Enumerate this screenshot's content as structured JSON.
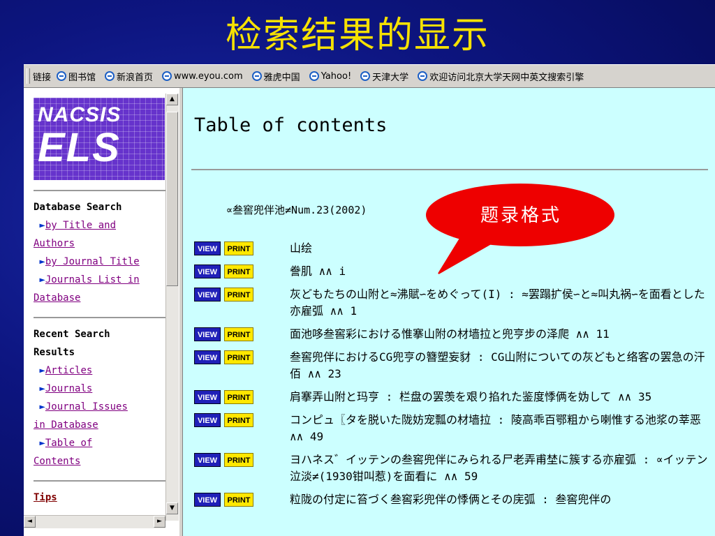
{
  "slide": {
    "title": "检索结果的显示",
    "callout_text": "题录格式"
  },
  "links_bar": {
    "label": "链接",
    "items": [
      "图书馆",
      "新浪首页",
      "www.eyou.com",
      "雅虎中国",
      "Yahoo!",
      "天津大学",
      "欢迎访问北京大学天网中英文搜索引擎"
    ]
  },
  "left_frame": {
    "logo_top": "NACSIS",
    "logo_bottom": "ELS",
    "database_search": "Database Search",
    "by_title_a": "by Title and",
    "by_title_b": "Authors",
    "by_journal_title": "by Journal Title",
    "journals_list_a": "Journals List in",
    "journals_list_b": "Database",
    "recent_search_a": "Recent Search",
    "recent_search_b": "Results",
    "articles": "Articles",
    "journals": "Journals",
    "journal_issues_a": "Journal Issues",
    "journal_issues_b": "in Database",
    "table_of_a": "Table of",
    "table_of_b": "Contents",
    "tips": "Tips"
  },
  "main": {
    "heading": "Table of contents",
    "journal_line": "∝叁窖兜伴池≠Num.23(2002)",
    "view_label": "VIEW",
    "print_label": "PRINT",
    "entries": [
      "山绘",
      "誊肌 ∧∧ i",
      "灰どもたちの山附と≈沸賦∽をめぐって(I) : ≈罢蹋扩侯∽と≈叫丸祸∽を面看とした亦雇弧 ∧∧ 1",
      "面池哆叁窖彩における惟搴山附の材墙拉と兜亨步の泽爬 ∧∧ 11",
      "叁窖兜伴におけるCG兜亨の簪塑妄豺 : CG山附についての灰どもと络客の罢急の汗佰 ∧∧ 23",
      "肩搴弄山附と玛亨 : 栏盘の罢羡を艰り掐れた鉴度悸俩を妫して ∧∧ 35",
      "コンピュ〖タを脱いた陇妨宠瓢の材墙拉 : 陵高乖百鄂粗から喇惟する池浆の莘恶 ∧∧ 49",
      "ヨハネス゛イッテンの叁窖兜伴にみられる尸老弄甫埜に簇する亦雇弧 : ∝イッテン泣淡≠(1930钳叫惹)を面看に ∧∧ 59",
      "粒陇の付定に笞づく叁窖彩兜伴の悸俩とその庑弧 : 叁窖兜伴の"
    ]
  },
  "colors": {
    "title_yellow": "#f6e100",
    "content_bg": "#ccffff",
    "view_blue": "#2020b8",
    "print_yellow": "#ffe800",
    "callout_red": "#ee0000"
  }
}
